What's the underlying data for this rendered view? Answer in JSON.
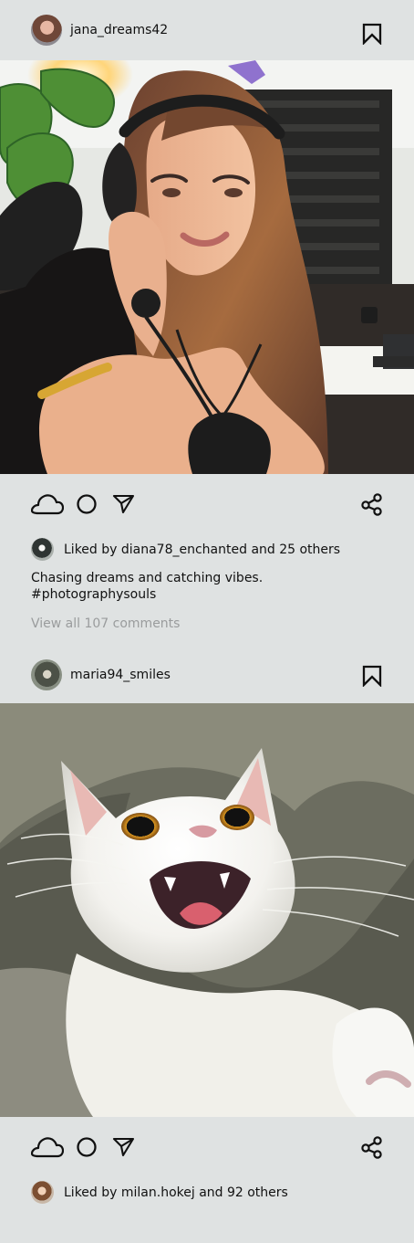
{
  "posts": [
    {
      "username": "jana_dreams42",
      "likes": "Liked by diana78_enchanted and 25 others",
      "caption_line1": "Chasing dreams and catching vibes.",
      "caption_line2": "#photographysouls",
      "comments_link": "View all 107 comments",
      "avatar_icon": "profile-photo",
      "image_subject": "woman-with-headphones",
      "actions": [
        "cloud-like-icon",
        "comment-icon",
        "send-icon",
        "share-icon",
        "bookmark-icon"
      ]
    },
    {
      "username": "maria94_smiles",
      "likes": "Liked by milan.hokej and 92 others",
      "avatar_icon": "profile-photo",
      "image_subject": "white-cat",
      "actions": [
        "cloud-like-icon",
        "comment-icon",
        "send-icon",
        "share-icon",
        "bookmark-icon"
      ]
    }
  ],
  "colors": {
    "background": "#dfe2e2",
    "text": "#111111",
    "muted_text": "#9a9c9d"
  }
}
